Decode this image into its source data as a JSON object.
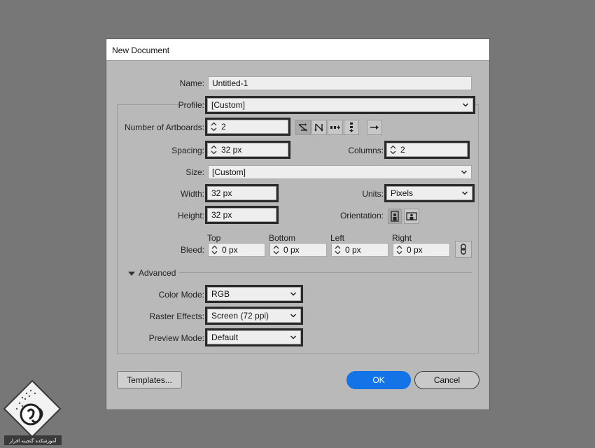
{
  "dialog": {
    "title": "New Document"
  },
  "name": {
    "label": "Name:",
    "value": "Untitled-1"
  },
  "profile": {
    "label": "Profile:",
    "value": "[Custom]"
  },
  "artboards": {
    "label": "Number of Artboards:",
    "value": "2"
  },
  "spacing": {
    "label": "Spacing:",
    "value": "32 px"
  },
  "columns": {
    "label": "Columns:",
    "value": "2"
  },
  "size": {
    "label": "Size:",
    "value": "[Custom]"
  },
  "width": {
    "label": "Width:",
    "value": "32 px"
  },
  "units": {
    "label": "Units:",
    "value": "Pixels"
  },
  "height": {
    "label": "Height:",
    "value": "32 px"
  },
  "orientation": {
    "label": "Orientation:"
  },
  "bleed": {
    "label": "Bleed:",
    "top": {
      "label": "Top",
      "value": "0 px"
    },
    "bottom": {
      "label": "Bottom",
      "value": "0 px"
    },
    "left": {
      "label": "Left",
      "value": "0 px"
    },
    "right": {
      "label": "Right",
      "value": "0 px"
    }
  },
  "advanced": {
    "label": "Advanced"
  },
  "color_mode": {
    "label": "Color Mode:",
    "value": "RGB"
  },
  "raster_effects": {
    "label": "Raster Effects:",
    "value": "Screen (72 ppi)"
  },
  "preview_mode": {
    "label": "Preview Mode:",
    "value": "Default"
  },
  "buttons": {
    "templates": "Templates...",
    "ok": "OK",
    "cancel": "Cancel"
  },
  "colors": {
    "accent": "#1473e6",
    "dialog_bg": "#b9b9b9",
    "backdrop": "#777777"
  },
  "watermark": {
    "text": "آموزشکده گنجینه افزار"
  }
}
